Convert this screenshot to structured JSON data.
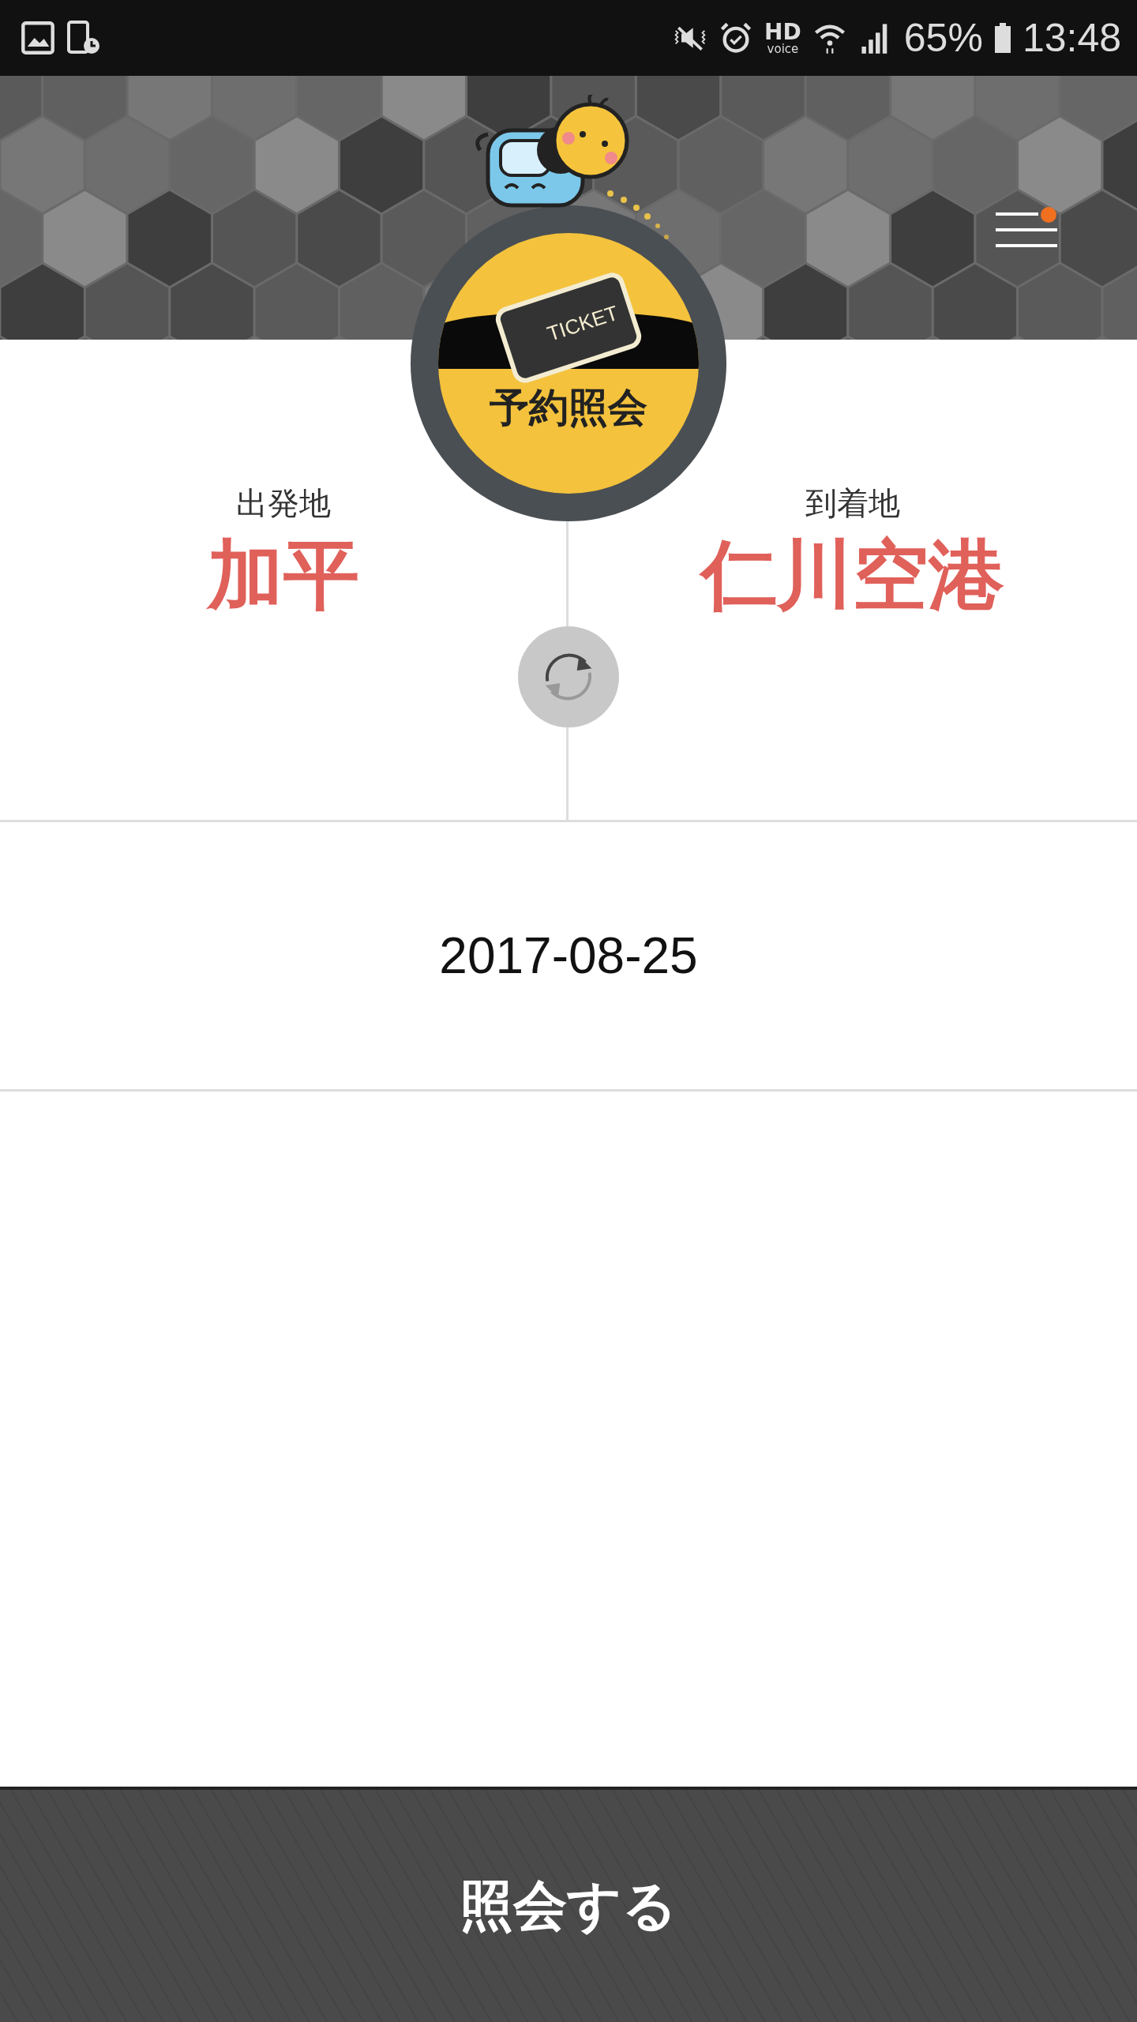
{
  "status_bar": {
    "hd_label": "HD",
    "voice_label": "voice",
    "battery": "65%",
    "time": "13:48"
  },
  "header": {
    "ticket_label": "TICKET",
    "title": "予約照会",
    "menu_notification": true
  },
  "route": {
    "departure": {
      "label": "出発地",
      "value": "加平"
    },
    "arrival": {
      "label": "到着地",
      "value": "仁川空港"
    }
  },
  "date": "2017-08-25",
  "submit_button": "照会する"
}
